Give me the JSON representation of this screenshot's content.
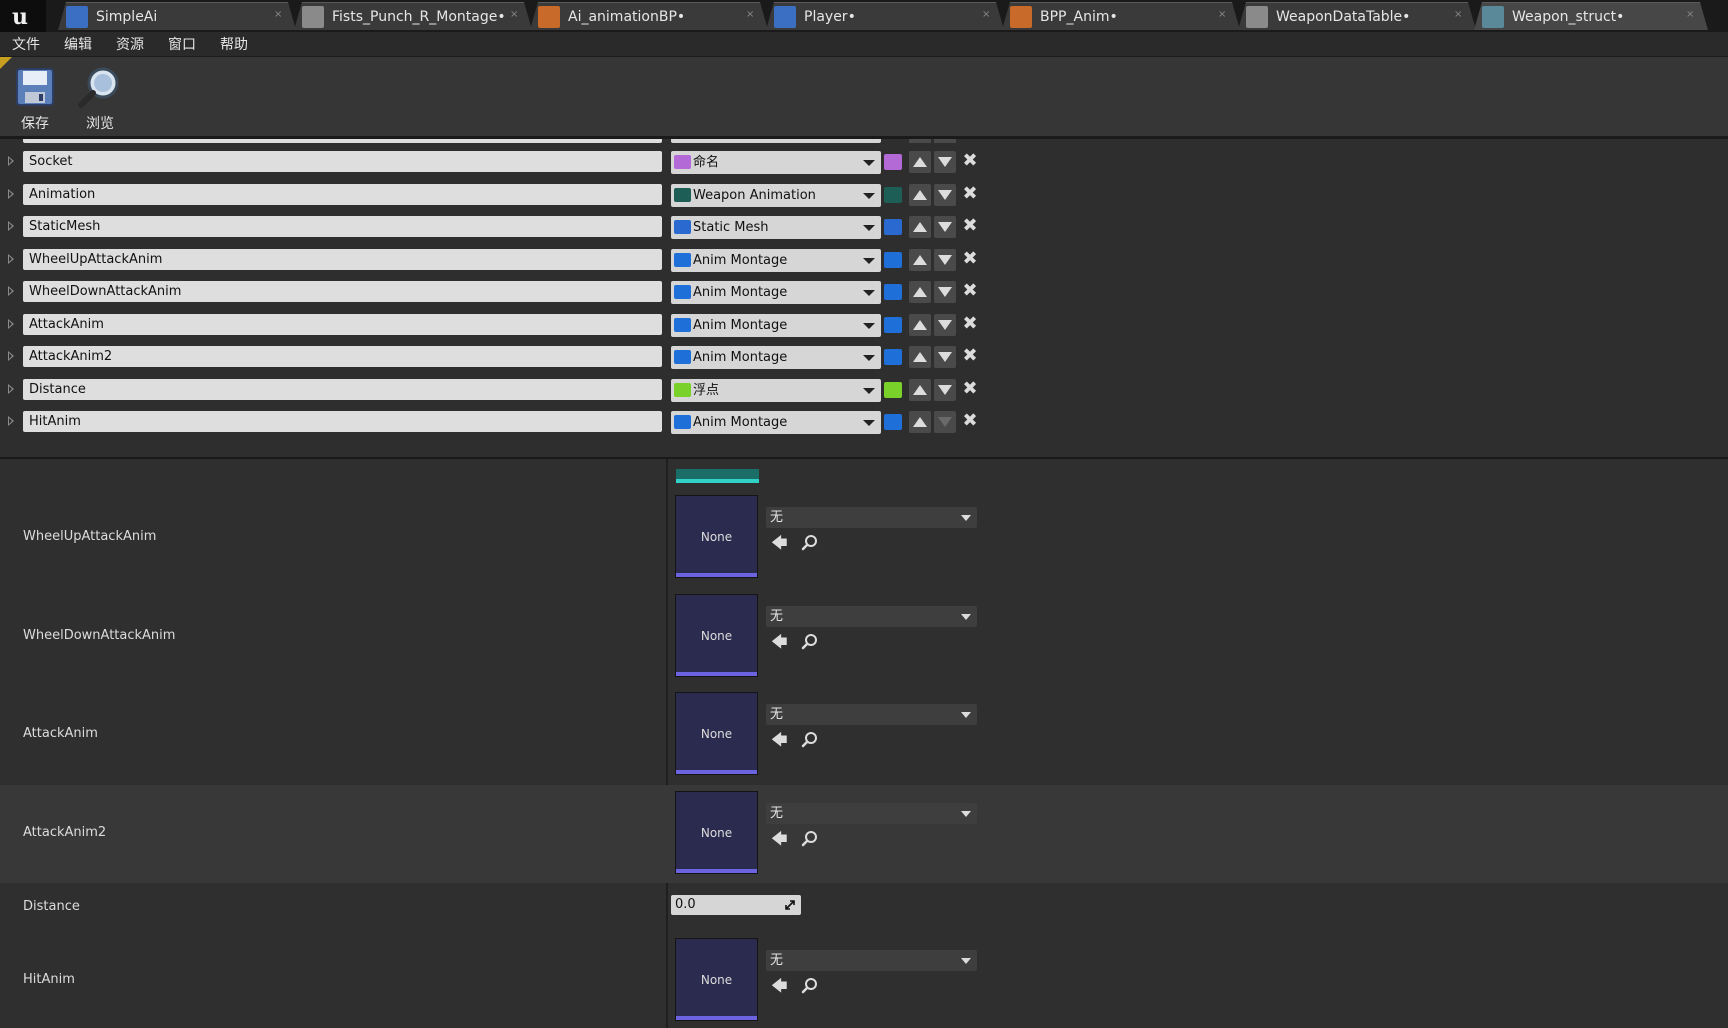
{
  "tabs": [
    {
      "label": "SimpleAi",
      "icon": "blueprint-icon",
      "color": "#3b6fc4"
    },
    {
      "label": "Fists_Punch_R_Montage•",
      "icon": "anim-montage-icon",
      "color": "#8a8a8a"
    },
    {
      "label": "Ai_animationBP•",
      "icon": "anim-blueprint-icon",
      "color": "#c86a2a"
    },
    {
      "label": "Player•",
      "icon": "blueprint-icon",
      "color": "#3b6fc4"
    },
    {
      "label": "BPP_Anim•",
      "icon": "anim-blueprint-icon",
      "color": "#c86a2a"
    },
    {
      "label": "WeaponDataTable•",
      "icon": "data-table-icon",
      "color": "#8a8a8a"
    },
    {
      "label": "Weapon_struct•",
      "icon": "struct-icon",
      "color": "#5a8a9a"
    }
  ],
  "menu": [
    "文件",
    "编辑",
    "资源",
    "窗口",
    "帮助"
  ],
  "toolbar": {
    "save_label": "保存",
    "browse_label": "浏览"
  },
  "structure_rows": [
    {
      "name": "Socket",
      "type": "命名",
      "type_color": "#b36ad6"
    },
    {
      "name": "Animation",
      "type": "Weapon Animation",
      "type_color": "#1d5e57"
    },
    {
      "name": "StaticMesh",
      "type": "Static Mesh",
      "type_color": "#2a6ad0"
    },
    {
      "name": "WheelUpAttackAnim",
      "type": "Anim Montage",
      "type_color": "#1e6fd8"
    },
    {
      "name": "WheelDownAttackAnim",
      "type": "Anim Montage",
      "type_color": "#1e6fd8"
    },
    {
      "name": "AttackAnim",
      "type": "Anim Montage",
      "type_color": "#1e6fd8"
    },
    {
      "name": "AttackAnim2",
      "type": "Anim Montage",
      "type_color": "#1e6fd8"
    },
    {
      "name": "Distance",
      "type": "浮点",
      "type_color": "#7ad12a"
    },
    {
      "name": "HitAnim",
      "type": "Anim Montage",
      "type_color": "#1e6fd8"
    }
  ],
  "defaults": {
    "asset_rows": [
      {
        "label": "WheelUpAttackAnim",
        "thumb": "None",
        "value": "无"
      },
      {
        "label": "WheelDownAttackAnim",
        "thumb": "None",
        "value": "无"
      },
      {
        "label": "AttackAnim",
        "thumb": "None",
        "value": "无"
      },
      {
        "label": "AttackAnim2",
        "thumb": "None",
        "value": "无"
      }
    ],
    "distance": {
      "label": "Distance",
      "value": "0.0"
    },
    "hitanim": {
      "label": "HitAnim",
      "thumb": "None",
      "value": "无"
    }
  }
}
